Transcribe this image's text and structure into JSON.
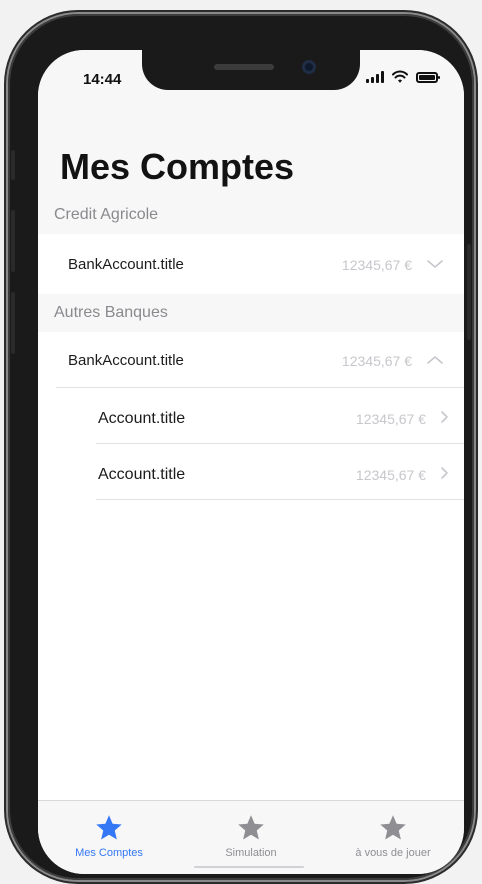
{
  "status_bar": {
    "time": "14:44"
  },
  "header": {
    "title": "Mes Comptes"
  },
  "sections": [
    {
      "name": "Credit Agricole",
      "rows": [
        {
          "title": "BankAccount.title",
          "amount": "12345,67 €",
          "chevron": "chevron-down-icon"
        }
      ]
    },
    {
      "name": "Autres Banques",
      "rows": [
        {
          "title": "BankAccount.title",
          "amount": "12345,67 €",
          "chevron": "chevron-up-icon"
        },
        {
          "title": "Account.title",
          "amount": "12345,67 €",
          "chevron": "chevron-right-icon"
        },
        {
          "title": "Account.title",
          "amount": "12345,67 €",
          "chevron": "chevron-right-icon"
        }
      ]
    }
  ],
  "tab_bar": {
    "tabs": [
      {
        "label": "Mes Comptes",
        "icon": "star-icon",
        "active": true
      },
      {
        "label": "Simulation",
        "icon": "star-icon",
        "active": false
      },
      {
        "label": "à vous de jouer",
        "icon": "star-icon",
        "active": false
      }
    ]
  },
  "colors": {
    "accent": "#3478f6",
    "inactive_icon": "#8e8e93",
    "amount_text": "#c7c7cc",
    "section_header_text": "#8a8a8e",
    "background_grouped": "#f7f7f8"
  }
}
